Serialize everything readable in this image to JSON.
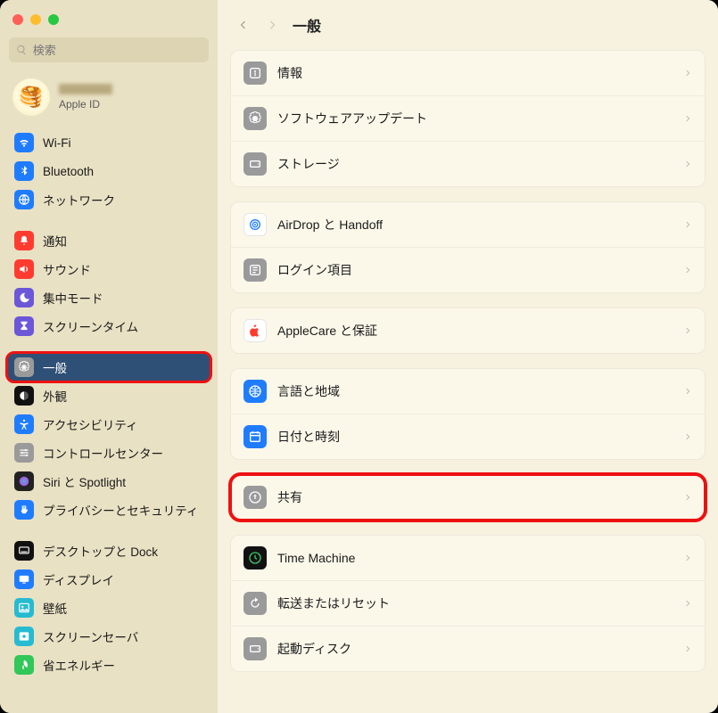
{
  "search": {
    "placeholder": "検索"
  },
  "account": {
    "sub": "Apple ID"
  },
  "title": "一般",
  "sidebar": {
    "items": [
      {
        "label": "Wi-Fi",
        "icon": "wifi",
        "bg": "#1f7cff"
      },
      {
        "label": "Bluetooth",
        "icon": "bluetooth",
        "bg": "#1f7cff"
      },
      {
        "label": "ネットワーク",
        "icon": "network",
        "bg": "#1f7cff"
      },
      {
        "label": "通知",
        "icon": "bell",
        "bg": "#ff3b30"
      },
      {
        "label": "サウンド",
        "icon": "sound",
        "bg": "#ff3b30"
      },
      {
        "label": "集中モード",
        "icon": "moon",
        "bg": "#6b57d8"
      },
      {
        "label": "スクリーンタイム",
        "icon": "hourglass",
        "bg": "#6b57d8"
      },
      {
        "label": "一般",
        "icon": "gear",
        "bg": "#9a9a9a",
        "selected": true,
        "hl": true
      },
      {
        "label": "外観",
        "icon": "appearance",
        "bg": "#111"
      },
      {
        "label": "アクセシビリティ",
        "icon": "accessibility",
        "bg": "#1f7cff"
      },
      {
        "label": "コントロールセンター",
        "icon": "sliders",
        "bg": "#9a9a9a"
      },
      {
        "label": "Siri と Spotlight",
        "icon": "siri",
        "bg": "#222"
      },
      {
        "label": "プライバシーとセキュリティ",
        "icon": "hand",
        "bg": "#1f7cff"
      },
      {
        "label": "デスクトップと Dock",
        "icon": "dock",
        "bg": "#111"
      },
      {
        "label": "ディスプレイ",
        "icon": "display",
        "bg": "#1f7cff"
      },
      {
        "label": "壁紙",
        "icon": "wallpaper",
        "bg": "#26bbd1"
      },
      {
        "label": "スクリーンセーバ",
        "icon": "screensaver",
        "bg": "#26bbd1"
      },
      {
        "label": "省エネルギー",
        "icon": "leaf",
        "bg": "#31c759"
      }
    ],
    "gaps_after": [
      2,
      6,
      12
    ]
  },
  "main": {
    "groups": [
      {
        "rows": [
          {
            "label": "情報",
            "icon": "info",
            "bg": "#9a9a9a"
          },
          {
            "label": "ソフトウェアアップデート",
            "icon": "gear",
            "bg": "#9a9a9a"
          },
          {
            "label": "ストレージ",
            "icon": "disk",
            "bg": "#9a9a9a"
          }
        ]
      },
      {
        "rows": [
          {
            "label": "AirDrop と Handoff",
            "icon": "airdrop",
            "bg": "#fff",
            "fg": "#1f7cff"
          },
          {
            "label": "ログイン項目",
            "icon": "login",
            "bg": "#9a9a9a"
          }
        ]
      },
      {
        "rows": [
          {
            "label": "AppleCare と保証",
            "icon": "apple",
            "bg": "#fff",
            "fg": "#ff3b30"
          }
        ]
      },
      {
        "rows": [
          {
            "label": "言語と地域",
            "icon": "globe",
            "bg": "#1f7cff"
          },
          {
            "label": "日付と時刻",
            "icon": "calendar",
            "bg": "#1f7cff"
          }
        ]
      },
      {
        "hl": true,
        "rows": [
          {
            "label": "共有",
            "icon": "share",
            "bg": "#9a9a9a"
          }
        ]
      },
      {
        "rows": [
          {
            "label": "Time Machine",
            "icon": "clock",
            "bg": "#111",
            "fg": "#3fc96a"
          },
          {
            "label": "転送またはリセット",
            "icon": "reset",
            "bg": "#9a9a9a"
          },
          {
            "label": "起動ディスク",
            "icon": "disk",
            "bg": "#9a9a9a"
          }
        ]
      }
    ]
  }
}
